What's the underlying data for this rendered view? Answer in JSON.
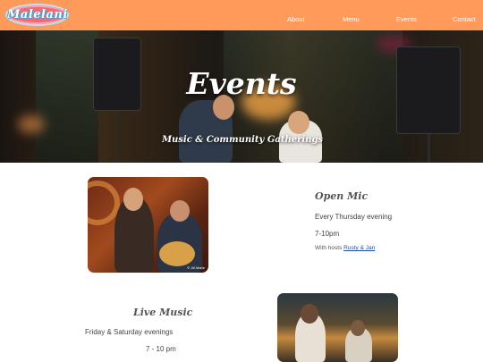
{
  "header": {
    "logo_text": "Malelani",
    "nav": [
      "About",
      "Menu",
      "Events",
      "Contact"
    ]
  },
  "hero": {
    "title": "Events",
    "subtitle": "Music & Community Gatherings"
  },
  "events": [
    {
      "title": "Open Mic",
      "schedule": "Every Thursday evening",
      "time": "7-10pm",
      "hosts_prefix": "With hosts ",
      "hosts_link": "Rusty & Jan",
      "photo_watermark": "© Jill Marie"
    },
    {
      "title": "Live Music",
      "schedule": "Friday & Saturday evenings",
      "time": "7 - 10 pm"
    }
  ],
  "colors": {
    "header_bg": "#ff9a5a",
    "link": "#1d4fa8",
    "logo_bg": "#f46a79"
  }
}
